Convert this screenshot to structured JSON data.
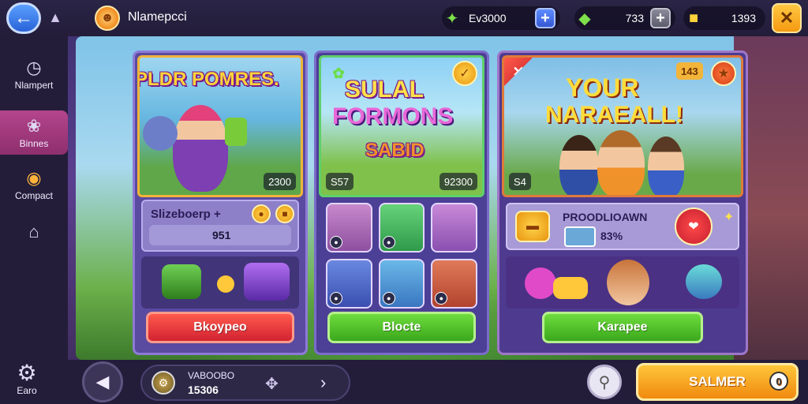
{
  "topbar": {
    "player_name": "Nlamepcci",
    "currencies": [
      {
        "icon": "gem-icon",
        "value": "Ev3000"
      },
      {
        "icon": "crystal-icon",
        "value": "733"
      },
      {
        "icon": "ticket-icon",
        "value": "1393"
      }
    ]
  },
  "sidebar": {
    "items": [
      {
        "label": "Nlampert",
        "icon": "clock-icon"
      },
      {
        "label": "Binnes",
        "icon": "chat-icon"
      },
      {
        "label": "Compact",
        "icon": "target-icon"
      },
      {
        "label": "",
        "icon": "house-icon"
      }
    ],
    "settings_label": "Earo"
  },
  "cards": [
    {
      "title": "PLDR POMRES.",
      "price": "2300",
      "info_title": "Slizeboerp +",
      "info_value": "951",
      "button": "Bkoypeo"
    },
    {
      "title_1": "SULAL",
      "title_2": "FORMONS",
      "title_3": "SABID",
      "left_tag": "S57",
      "price": "92300",
      "button": "Blocte"
    },
    {
      "title_1": "YOUR",
      "title_2": "NARAEALL!",
      "badge": "143",
      "left_tag": "S4",
      "offer_title": "PROODLIOAWN",
      "offer_pct": "83%",
      "button": "Karapee"
    }
  ],
  "footer": {
    "line1": "VABOOBO",
    "line2": "15306",
    "cta": "SALMER",
    "cta_count": "0"
  }
}
